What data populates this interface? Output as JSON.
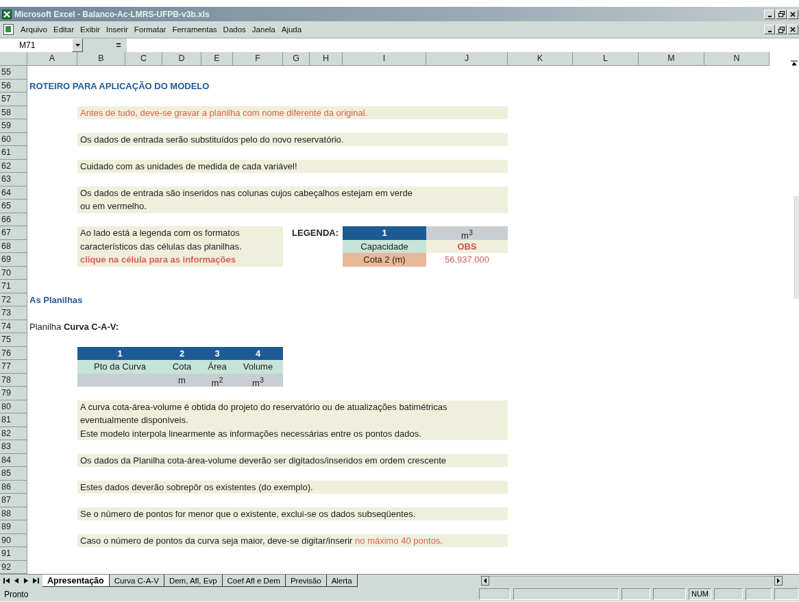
{
  "window": {
    "title": "Microsoft Excel - Balanco-Ac-LMRS-UFPB-v3b.xls"
  },
  "menu_bar": {
    "items": [
      "Arquivo",
      "Editar",
      "Exibir",
      "Inserir",
      "Formatar",
      "Ferramentas",
      "Dados",
      "Janela",
      "Ajuda"
    ]
  },
  "formula_bar": {
    "name_box": "M71",
    "equals": "="
  },
  "column_headers": [
    "A",
    "B",
    "C",
    "D",
    "E",
    "F",
    "G",
    "H",
    "I",
    "J",
    "K",
    "L",
    "M",
    "N"
  ],
  "row_headers": [
    "55",
    "56",
    "57",
    "58",
    "59",
    "60",
    "61",
    "62",
    "63",
    "64",
    "65",
    "66",
    "67",
    "68",
    "69",
    "70",
    "71",
    "72",
    "73",
    "74",
    "75",
    "76",
    "77",
    "78",
    "79",
    "80",
    "81",
    "82",
    "83",
    "84",
    "85",
    "86",
    "87",
    "88",
    "89",
    "90",
    "91",
    "92"
  ],
  "blocks": [
    {
      "kind": "heading",
      "text": "ROTEIRO PARA APLICAÇÃO DO MODELO"
    },
    {
      "kind": "alert-note",
      "lines": [
        "Antes de tudo,  deve-se gravar a planilha com nome diferente da original."
      ]
    },
    {
      "kind": "note",
      "lines": [
        "Os dados de entrada serão substituídos pelo do novo reservatório."
      ]
    },
    {
      "kind": "note",
      "lines": [
        "Cuidado com as unidades de medida de cada variável!"
      ]
    },
    {
      "kind": "note",
      "lines": [
        "Os dados de entrada são inseridos nas colunas cujos cabeçalhos estejam em verde",
        "ou em vermelho."
      ]
    },
    {
      "kind": "legend",
      "description": [
        "Ao lado está a legenda com os formatos",
        "característicos das células das planilhas."
      ],
      "hint": "clique na célula para as informações",
      "label": "LEGENDA:",
      "cells": [
        {
          "kind": "index",
          "text": "1"
        },
        {
          "kind": "unit",
          "text": "m$^{3}$"
        },
        {
          "kind": "input",
          "text": "Capacidade"
        },
        {
          "kind": "obs",
          "text": "OBS"
        },
        {
          "kind": "output",
          "text": "Cota 2 (m)"
        },
        {
          "kind": "value",
          "text": "56.937.000"
        }
      ]
    },
    {
      "kind": "subheading",
      "text": "As Planilhas"
    },
    {
      "kind": "label",
      "text": "Planilha **Curva C-A-V:**"
    },
    {
      "kind": "table",
      "columns": [
        {
          "index": "1",
          "header": "Pto da Curva"
        },
        {
          "index": "2",
          "header": "Cota",
          "unit": "m"
        },
        {
          "index": "3",
          "header": "Área",
          "unit": "m$^{2}$"
        },
        {
          "index": "4",
          "header": "Volume",
          "unit": "m$^{3}$"
        }
      ]
    },
    {
      "kind": "note",
      "lines": [
        "A curva cota-área-volume é obtida do projeto do reservatório ou de atualizações batimétricas",
        "eventualmente disponíveis.",
        "Este modelo interpola linearmente as informações necessárias entre os pontos dados."
      ]
    },
    {
      "kind": "note",
      "lines": [
        "Os dados da Planilha cota-área-volume deverão ser digitados/inseridos em ordem crescente"
      ]
    },
    {
      "kind": "note",
      "lines": [
        "Estes dados deverão sobrepôr os existentes (do exemplo)."
      ]
    },
    {
      "kind": "note",
      "lines": [
        "Se o número de pontos for menor que o existente, exclui-se os dados subseqüentes."
      ]
    },
    {
      "kind": "note",
      "lines": [
        "Caso o número de pontos da curva seja maior, deve-se digitar/inserir"
      ],
      "highlight": "no máximo 40 pontos."
    }
  ],
  "sheet_tabs": [
    {
      "label": "Apresentação",
      "selected": true
    },
    {
      "label": "Curva C-A-V",
      "selected": false
    },
    {
      "label": "Dem, Afl, Evp",
      "selected": false
    },
    {
      "label": "Coef Afl e Dem",
      "selected": false
    },
    {
      "label": "Previsão",
      "selected": false
    },
    {
      "label": "Alerta",
      "selected": false
    }
  ],
  "status_bar": {
    "text": "Pronto",
    "indicators": [
      "NUM"
    ]
  }
}
